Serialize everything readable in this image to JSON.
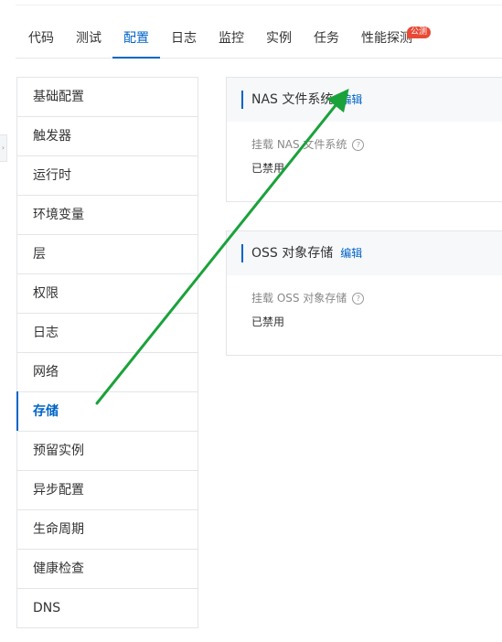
{
  "tabs": [
    {
      "label": "代码"
    },
    {
      "label": "测试"
    },
    {
      "label": "配置"
    },
    {
      "label": "日志"
    },
    {
      "label": "监控"
    },
    {
      "label": "实例"
    },
    {
      "label": "任务"
    },
    {
      "label": "性能探测",
      "badge": "公测"
    }
  ],
  "active_tab": "配置",
  "sidebar": {
    "items": [
      {
        "label": "基础配置"
      },
      {
        "label": "触发器"
      },
      {
        "label": "运行时"
      },
      {
        "label": "环境变量"
      },
      {
        "label": "层"
      },
      {
        "label": "权限"
      },
      {
        "label": "日志"
      },
      {
        "label": "网络"
      },
      {
        "label": "存储"
      },
      {
        "label": "预留实例"
      },
      {
        "label": "异步配置"
      },
      {
        "label": "生命周期"
      },
      {
        "label": "健康检查"
      },
      {
        "label": "DNS"
      }
    ],
    "active_item": "存储"
  },
  "nas": {
    "title": "NAS 文件系统",
    "edit": "编辑",
    "field_label": "挂载 NAS 文件系统",
    "help": "?",
    "value": "已禁用"
  },
  "oss": {
    "title": "OSS 对象存储",
    "edit": "编辑",
    "field_label": "挂载 OSS 对象存储",
    "help": "?",
    "value": "已禁用"
  },
  "colors": {
    "accent": "#0064c8",
    "badge": "#e84a35",
    "annotation_arrow": "#1aa23a"
  },
  "icons": {
    "help": "question-circle-icon",
    "collapse": "chevron-right-icon",
    "annotation": "arrow-annotation"
  }
}
